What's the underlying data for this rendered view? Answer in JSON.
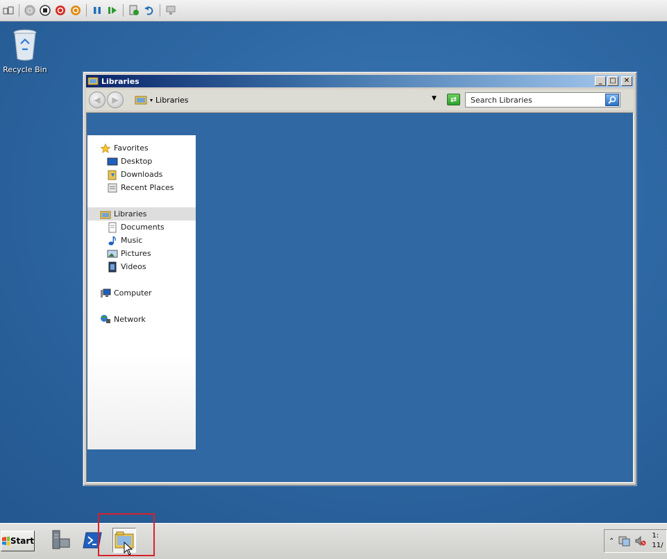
{
  "desktop": {
    "recycle_bin_label": "Recycle Bin"
  },
  "window": {
    "title": "Libraries",
    "minimize_label": "_",
    "maximize_label": "□",
    "close_label": "✕",
    "address": "Libraries",
    "search_placeholder": "Search Libraries"
  },
  "nav_pane": {
    "favorites": {
      "label": "Favorites",
      "items": [
        {
          "label": "Desktop",
          "icon": "desktop-icon"
        },
        {
          "label": "Downloads",
          "icon": "downloads-icon"
        },
        {
          "label": "Recent Places",
          "icon": "recent-places-icon"
        }
      ]
    },
    "libraries": {
      "label": "Libraries",
      "selected": true,
      "items": [
        {
          "label": "Documents",
          "icon": "documents-icon"
        },
        {
          "label": "Music",
          "icon": "music-icon"
        },
        {
          "label": "Pictures",
          "icon": "pictures-icon"
        },
        {
          "label": "Videos",
          "icon": "videos-icon"
        }
      ]
    },
    "computer": {
      "label": "Computer"
    },
    "network": {
      "label": "Network"
    }
  },
  "taskbar": {
    "start_label": "Start",
    "pinned": [
      "server-manager-icon",
      "powershell-icon",
      "explorer-icon"
    ],
    "clock_line1": "1:",
    "clock_line2": "11/"
  },
  "colors": {
    "desktop": "#2f6aa6",
    "titlebar_start": "#0a246a",
    "titlebar_end": "#a6caf0",
    "highlight": "#d8212a"
  }
}
